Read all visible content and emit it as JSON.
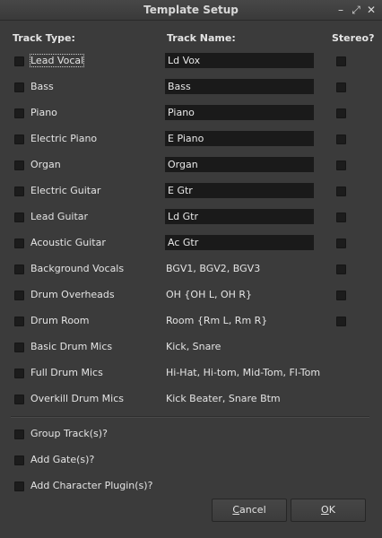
{
  "window": {
    "title": "Template Setup",
    "controls": [
      "minimize-icon",
      "maximize-icon",
      "close-icon"
    ]
  },
  "headers": {
    "track_type": "Track Type:",
    "track_name": "Track Name:",
    "stereo": "Stereo?"
  },
  "tracks": [
    {
      "type": "Lead Vocal",
      "name": "Ld Vox",
      "editable": true,
      "stereo_option": true,
      "focused": true
    },
    {
      "type": "Bass",
      "name": "Bass",
      "editable": true,
      "stereo_option": true
    },
    {
      "type": "Piano",
      "name": "Piano",
      "editable": true,
      "stereo_option": true
    },
    {
      "type": "Electric Piano",
      "name": "E Piano",
      "editable": true,
      "stereo_option": true
    },
    {
      "type": "Organ",
      "name": "Organ",
      "editable": true,
      "stereo_option": true
    },
    {
      "type": "Electric Guitar",
      "name": "E Gtr",
      "editable": true,
      "stereo_option": true
    },
    {
      "type": "Lead Guitar",
      "name": "Ld Gtr",
      "editable": true,
      "stereo_option": true
    },
    {
      "type": "Acoustic Guitar",
      "name": "Ac Gtr",
      "editable": true,
      "stereo_option": true
    },
    {
      "type": "Background Vocals",
      "name": "BGV1, BGV2, BGV3",
      "editable": false,
      "stereo_option": true
    },
    {
      "type": "Drum Overheads",
      "name": "OH {OH L, OH R}",
      "editable": false,
      "stereo_option": true
    },
    {
      "type": "Drum Room",
      "name": "Room {Rm L, Rm R}",
      "editable": false,
      "stereo_option": true
    },
    {
      "type": "Basic Drum Mics",
      "name": "Kick, Snare",
      "editable": false,
      "stereo_option": false
    },
    {
      "type": "Full Drum Mics",
      "name": "Hi-Hat, Hi-tom, Mid-Tom, Fl-Tom",
      "editable": false,
      "stereo_option": false
    },
    {
      "type": "Overkill Drum Mics",
      "name": "Kick Beater, Snare Btm",
      "editable": false,
      "stereo_option": false
    }
  ],
  "options": [
    {
      "label": "Group Track(s)?"
    },
    {
      "label": "Add Gate(s)?"
    },
    {
      "label": "Add Character Plugin(s)?"
    }
  ],
  "buttons": {
    "cancel": {
      "mnemonic": "C",
      "rest": "ancel"
    },
    "ok": {
      "mnemonic": "O",
      "rest": "K"
    }
  }
}
